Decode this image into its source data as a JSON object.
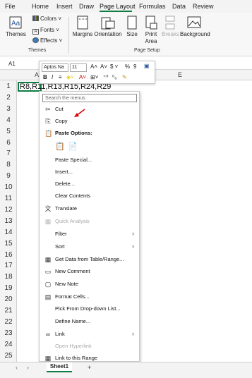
{
  "ribbon_tabs": [
    "File",
    "Home",
    "Insert",
    "Draw",
    "Page Layout",
    "Formulas",
    "Data",
    "Review"
  ],
  "ribbon": {
    "themes": "Themes",
    "colors": "Colors",
    "fonts": "Fonts",
    "effects": "Effects",
    "margins": "Margins",
    "orientation": "Orientation",
    "size": "Size",
    "print_area": "Print\nArea",
    "breaks": "Breaks",
    "background": "Background",
    "group_themes": "Themes",
    "group_page_setup": "Page Setup"
  },
  "name_box": "A1",
  "mini_toolbar": {
    "font": "Aptos Na",
    "size": "11",
    "bold": "B",
    "italic": "I"
  },
  "columns": [
    "A",
    "E"
  ],
  "rows": [
    "1",
    "2",
    "3",
    "4",
    "5",
    "6",
    "7",
    "8",
    "9",
    "10",
    "11",
    "12",
    "13",
    "14",
    "15",
    "16",
    "17",
    "18",
    "19",
    "20",
    "21",
    "22",
    "23",
    "24",
    "25"
  ],
  "cell_a1": "R8,R11,R13,R15,R24,R29",
  "context_menu": {
    "search_placeholder": "Search the menus",
    "items": [
      {
        "label": "Cut",
        "icon": "✂",
        "disabled": false
      },
      {
        "label": "Copy",
        "icon": "⎘",
        "disabled": false
      },
      {
        "label": "Paste Options:",
        "icon": "📋",
        "disabled": false,
        "bold": true
      },
      {
        "label": "Paste Special...",
        "icon": "",
        "disabled": false
      },
      {
        "label": "Insert...",
        "icon": "",
        "disabled": false
      },
      {
        "label": "Delete...",
        "icon": "",
        "disabled": false
      },
      {
        "label": "Clear Contents",
        "icon": "",
        "disabled": false
      },
      {
        "label": "Translate",
        "icon": "文",
        "disabled": false
      },
      {
        "label": "Quick Analysis",
        "icon": "▦",
        "disabled": true
      },
      {
        "label": "Filter",
        "icon": "",
        "disabled": false,
        "submenu": true
      },
      {
        "label": "Sort",
        "icon": "",
        "disabled": false,
        "submenu": true
      },
      {
        "label": "Get Data from Table/Range...",
        "icon": "▦",
        "disabled": false
      },
      {
        "label": "New Comment",
        "icon": "▭",
        "disabled": false
      },
      {
        "label": "New Note",
        "icon": "▢",
        "disabled": false
      },
      {
        "label": "Format Cells...",
        "icon": "▤",
        "disabled": false
      },
      {
        "label": "Pick From Drop-down List...",
        "icon": "",
        "disabled": false
      },
      {
        "label": "Define Name...",
        "icon": "",
        "disabled": false
      },
      {
        "label": "Link",
        "icon": "∞",
        "disabled": false,
        "submenu": true
      },
      {
        "label": "Open Hyperlink",
        "icon": "",
        "disabled": true
      },
      {
        "label": "Link to this Range",
        "icon": "▦",
        "disabled": false
      }
    ]
  },
  "sheet_tab": "Sheet1",
  "add_sheet": "+",
  "accent_color": "#107c41"
}
